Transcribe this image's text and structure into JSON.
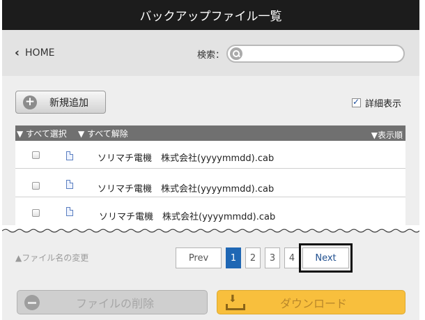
{
  "header": {
    "title": "バックアップファイル一覧"
  },
  "nav": {
    "home_label": "HOME",
    "search_label": "検索：",
    "search_value": "",
    "search_placeholder": ""
  },
  "toolbar": {
    "add_label": "新規追加",
    "detail_label": "詳細表示",
    "detail_checked": true
  },
  "list": {
    "select_all": "▼ すべて選択",
    "deselect_all": "▼ すべて解除",
    "sort_order": "▼表示順",
    "rows": [
      {
        "filename": "ソリマチ電機　株式会社(yyyymmdd).cab"
      },
      {
        "filename": "ソリマチ電機　株式会社(yyyymmdd).cab"
      },
      {
        "filename": "ソリマチ電機　株式会社(yyyymmdd).cab"
      }
    ]
  },
  "footer": {
    "rename_label": "▲ファイル名の変更",
    "pagination": {
      "prev": "Prev",
      "pages": [
        "1",
        "2",
        "3",
        "4"
      ],
      "current": "1",
      "next": "Next"
    },
    "delete_label": "ファイルの削除",
    "download_label": "ダウンロード"
  },
  "colors": {
    "title_bg": "#1c1c1c",
    "active_page": "#1f67b4",
    "download_button": "#f8bf3d",
    "list_header": "#707070"
  }
}
